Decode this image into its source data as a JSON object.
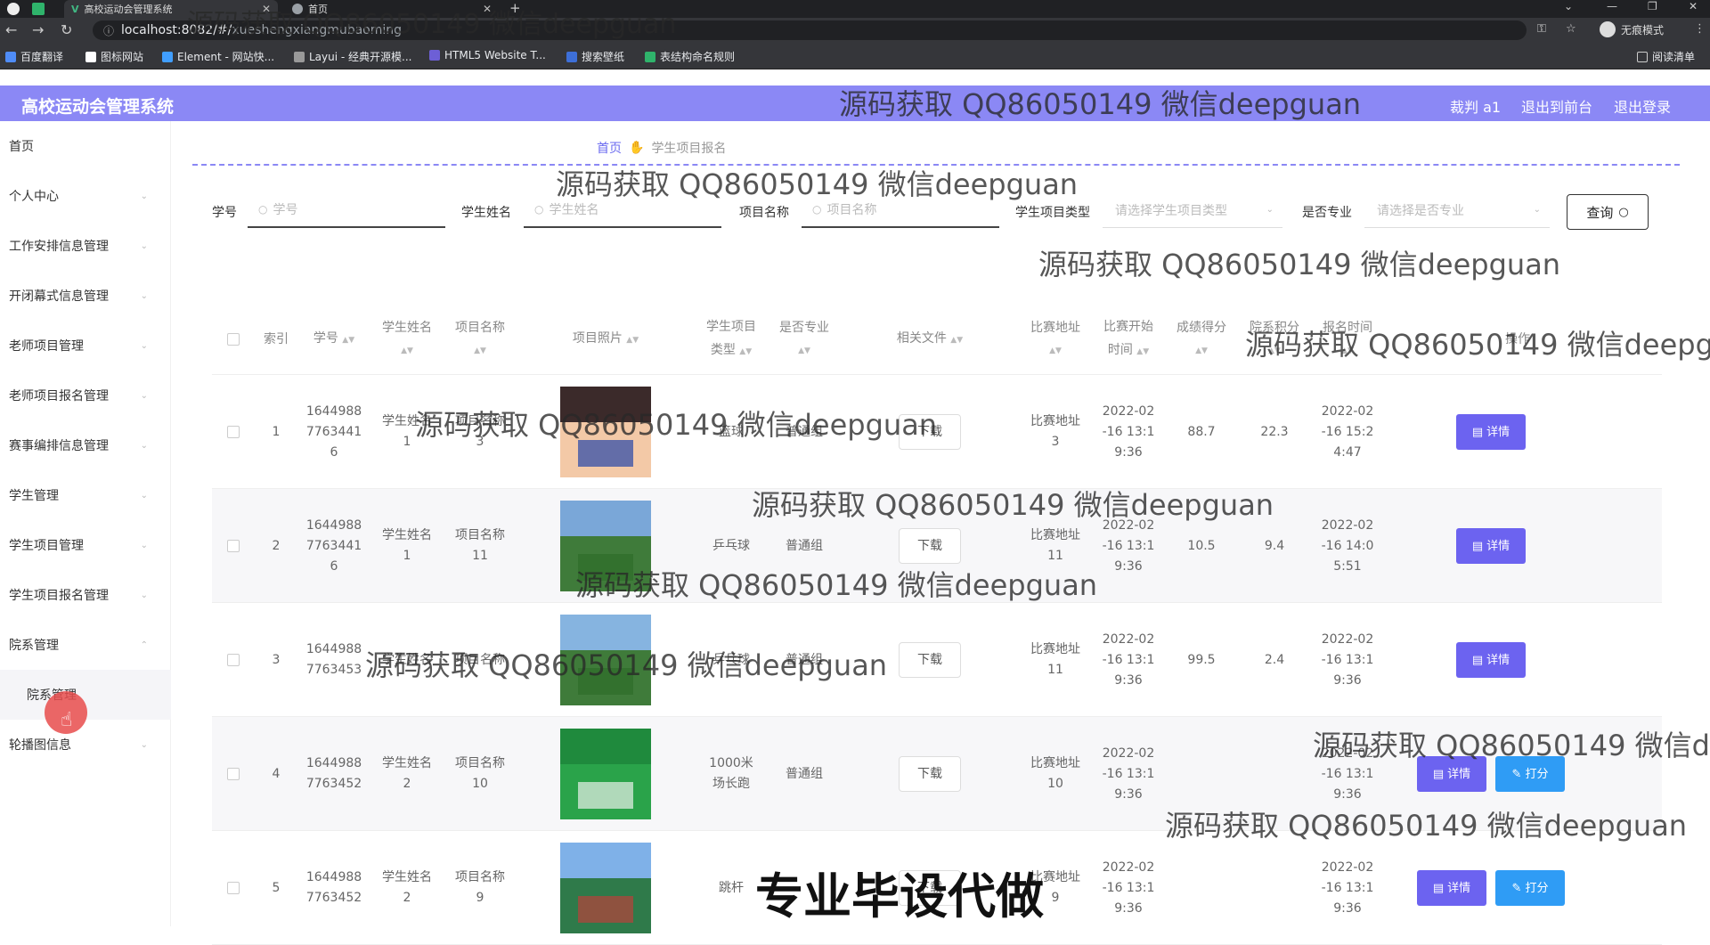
{
  "browser": {
    "tabs": [
      {
        "title": "高校运动会管理系统"
      },
      {
        "title": "首页"
      }
    ],
    "url_host": "localhost:8082/#/",
    "url_path": "xueshengxiangmubaoming",
    "incognito_label": "无痕模式",
    "bookmarks": [
      "百度翻译",
      "图标网站",
      "Element - 网站快...",
      "Layui - 经典开源模...",
      "HTML5 Website T...",
      "搜索壁纸",
      "表结构命名规则"
    ],
    "reading_list": "阅读清单"
  },
  "header": {
    "brand": "高校运动会管理系统",
    "user": "裁判 a1",
    "to_front": "退出到前台",
    "logout": "退出登录"
  },
  "sidebar": {
    "items": [
      {
        "label": "首页"
      },
      {
        "label": "个人中心"
      },
      {
        "label": "工作安排信息管理"
      },
      {
        "label": "开闭幕式信息管理"
      },
      {
        "label": "老师项目管理"
      },
      {
        "label": "老师项目报名管理"
      },
      {
        "label": "赛事编排信息管理"
      },
      {
        "label": "学生管理"
      },
      {
        "label": "学生项目管理"
      },
      {
        "label": "学生项目报名管理"
      },
      {
        "label": "院系管理"
      },
      {
        "label": "院系管理"
      },
      {
        "label": "轮播图信息"
      }
    ]
  },
  "breadcrumb": {
    "home": "首页",
    "current": "学生项目报名"
  },
  "search": {
    "fields": [
      {
        "label": "学号",
        "placeholder": "学号"
      },
      {
        "label": "学生姓名",
        "placeholder": "学生姓名"
      },
      {
        "label": "项目名称",
        "placeholder": "项目名称"
      }
    ],
    "selects": [
      {
        "label": "学生项目类型",
        "placeholder": "请选择学生项目类型"
      },
      {
        "label": "是否专业",
        "placeholder": "请选择是否专业"
      }
    ],
    "query_label": "查询"
  },
  "table": {
    "headers": {
      "index": "索引",
      "student_no": "学号",
      "name_l1": "学生姓名",
      "project_l1": "项目名称",
      "photo": "项目照片",
      "type_l1": "学生项目",
      "type_l2": "类型",
      "pro_l1": "是否专业",
      "files": "相关文件",
      "addr": "比赛地址",
      "start_l1": "比赛开始",
      "start_l2": "时间",
      "score": "成绩得分",
      "points": "院系积分",
      "reg_l1": "报名时间",
      "ops": "操作"
    },
    "download_label": "下载",
    "detail_label": "详情",
    "score_label": "打分",
    "rows": [
      {
        "index": "1",
        "sno_1": "1644988",
        "sno_2": "7763441",
        "sno_3": "6",
        "name_1": "学生姓名",
        "name_2": "1",
        "proj_1": "项目名称",
        "proj_2": "3",
        "type_1": "篮球",
        "type_2": "",
        "pro": "普通组",
        "addr_1": "比赛地址",
        "addr_2": "3",
        "start_1": "2022-02",
        "start_2": "-16 13:1",
        "start_3": "9:36",
        "score": "88.7",
        "points": "22.3",
        "reg_1": "2022-02",
        "reg_2": "-16 15:2",
        "reg_3": "4:47",
        "photo_colors": [
          "#3b2a2a",
          "#f3c9a7",
          "#2546a8"
        ]
      },
      {
        "index": "2",
        "sno_1": "1644988",
        "sno_2": "7763441",
        "sno_3": "6",
        "name_1": "学生姓名",
        "name_2": "1",
        "proj_1": "项目名称",
        "proj_2": "11",
        "type_1": "乒乓球",
        "type_2": "",
        "pro": "普通组",
        "addr_1": "比赛地址",
        "addr_2": "11",
        "start_1": "2022-02",
        "start_2": "-16 13:1",
        "start_3": "9:36",
        "score": "10.5",
        "points": "9.4",
        "reg_1": "2022-02",
        "reg_2": "-16 14:0",
        "reg_3": "5:51",
        "photo_colors": [
          "#7aa7d8",
          "#3f7b3a",
          "#2f6e2a"
        ]
      },
      {
        "index": "3",
        "sno_1": "1644988",
        "sno_2": "7763453",
        "sno_3": "",
        "name_1": "学生姓名",
        "name_2": "",
        "proj_1": "项目名称",
        "proj_2": "",
        "type_1": "乒乓球",
        "type_2": "",
        "pro": "普通组",
        "addr_1": "比赛地址",
        "addr_2": "11",
        "start_1": "2022-02",
        "start_2": "-16 13:1",
        "start_3": "9:36",
        "score": "99.5",
        "points": "2.4",
        "reg_1": "2022-02",
        "reg_2": "-16 13:1",
        "reg_3": "9:36",
        "photo_colors": [
          "#86b4e0",
          "#3f7b3a",
          "#2f6e2a"
        ]
      },
      {
        "index": "4",
        "sno_1": "1644988",
        "sno_2": "7763452",
        "sno_3": "",
        "name_1": "学生姓名",
        "name_2": "2",
        "proj_1": "项目名称",
        "proj_2": "10",
        "type_1": "1000米",
        "type_2": "场长跑",
        "pro": "普通组",
        "addr_1": "比赛地址",
        "addr_2": "10",
        "start_1": "2022-02",
        "start_2": "-16 13:1",
        "start_3": "9:36",
        "score": "",
        "points": "",
        "reg_1": "2022-02",
        "reg_2": "-16 13:1",
        "reg_3": "9:36",
        "photo_colors": [
          "#1f8a3d",
          "#2aa34a",
          "#e9f0ea"
        ]
      },
      {
        "index": "5",
        "sno_1": "1644988",
        "sno_2": "7763452",
        "sno_3": "",
        "name_1": "学生姓名",
        "name_2": "2",
        "proj_1": "项目名称",
        "proj_2": "9",
        "type_1": "跳杆",
        "type_2": "",
        "pro": "",
        "addr_1": "比赛地址",
        "addr_2": "9",
        "start_1": "2022-02",
        "start_2": "-16 13:1",
        "start_3": "9:36",
        "score": "",
        "points": "",
        "reg_1": "2022-02",
        "reg_2": "-16 13:1",
        "reg_3": "9:36",
        "photo_colors": [
          "#7fb1e8",
          "#2f7a4a",
          "#b8413a"
        ]
      }
    ]
  },
  "watermark": {
    "text": "源码获取 QQ86050149 微信deepguan",
    "big": "专业毕设代做"
  },
  "colors": {
    "header_bg": "#8b88f5",
    "detail_btn": "#6c63f0",
    "score_btn": "#2f9cf5"
  }
}
